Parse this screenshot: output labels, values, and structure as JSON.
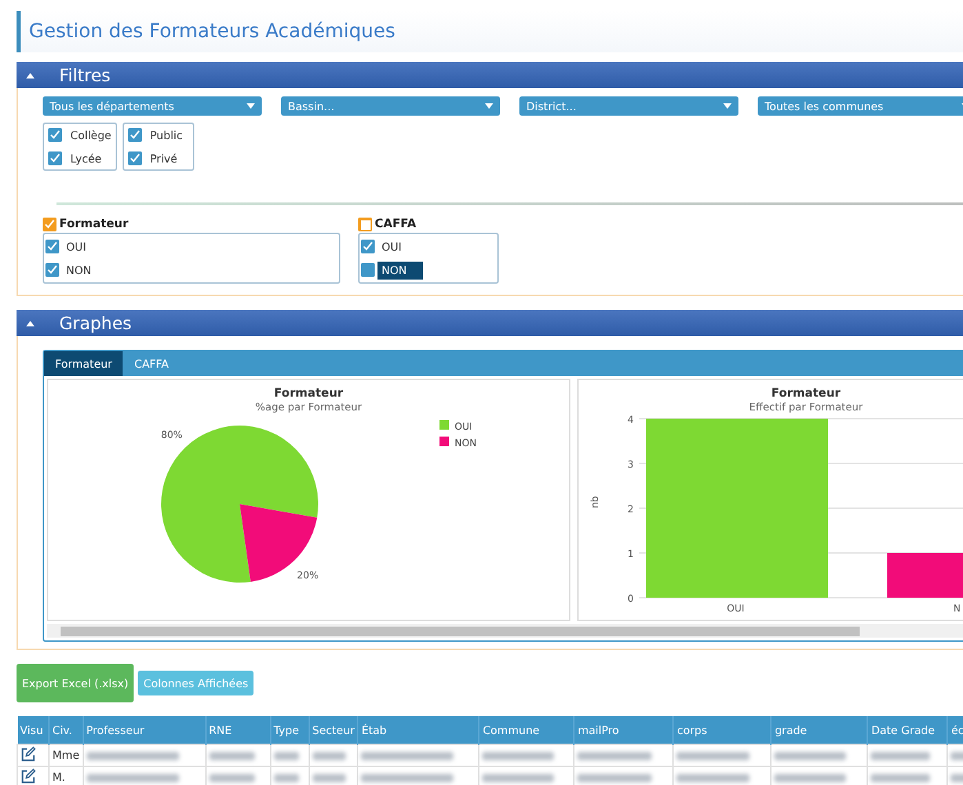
{
  "title": "Gestion des Formateurs Académiques",
  "filters": {
    "title": "Filtres",
    "dropdowns": [
      "Tous les départements",
      "Bassin...",
      "District...",
      "Toutes les communes"
    ],
    "check_groups": [
      {
        "items": [
          {
            "label": "Collège",
            "checked": true
          },
          {
            "label": "Lycée",
            "checked": true
          }
        ]
      },
      {
        "items": [
          {
            "label": "Public",
            "checked": true
          },
          {
            "label": "Privé",
            "checked": true
          }
        ]
      }
    ],
    "choice_groups": [
      {
        "title": "Formateur",
        "checked": true,
        "options": [
          {
            "label": "OUI",
            "checked": true,
            "selected": false
          },
          {
            "label": "NON",
            "checked": true,
            "selected": false
          }
        ]
      },
      {
        "title": "CAFFA",
        "checked": false,
        "options": [
          {
            "label": "OUI",
            "checked": true,
            "selected": false
          },
          {
            "label": "NON",
            "checked": false,
            "selected": true
          }
        ]
      }
    ]
  },
  "graphs": {
    "title": "Graphes",
    "tabs": [
      {
        "label": "Formateur",
        "selected": true
      },
      {
        "label": "CAFFA",
        "selected": false
      }
    ],
    "pie": {
      "subtitle": "%age par Formateur",
      "chart_data": {
        "type": "pie",
        "title": "Formateur",
        "categories": [
          "OUI",
          "NON"
        ],
        "values": [
          80,
          20
        ],
        "colors": [
          "#7ed933",
          "#f20c79"
        ],
        "value_labels": [
          "80%",
          "20%"
        ],
        "legend": true
      }
    },
    "bar": {
      "subtitle": "Effectif par Formateur",
      "chart_data": {
        "type": "bar",
        "title": "Formateur",
        "ylabel": "nb",
        "categories": [
          "OUI",
          "N"
        ],
        "values": [
          4,
          1
        ],
        "colors": [
          "#7ed933",
          "#f20c79"
        ],
        "ylim": [
          0,
          4
        ],
        "yticks": [
          0,
          1,
          2,
          3,
          4
        ],
        "grid": true
      }
    }
  },
  "buttons": [
    {
      "kind": "export",
      "label": "Export Excel (.xlsx)"
    },
    {
      "kind": "columns",
      "label": "Colonnes Affichées"
    }
  ],
  "table": {
    "columns": [
      "Visu",
      "Civ.",
      "Professeur",
      "RNE",
      "Type",
      "Secteur",
      "Étab",
      "Commune",
      "mailPro",
      "corps",
      "grade",
      "Date Grade",
      "éc"
    ],
    "rows": [
      {
        "civ": "Mme"
      },
      {
        "civ": "M."
      }
    ]
  }
}
